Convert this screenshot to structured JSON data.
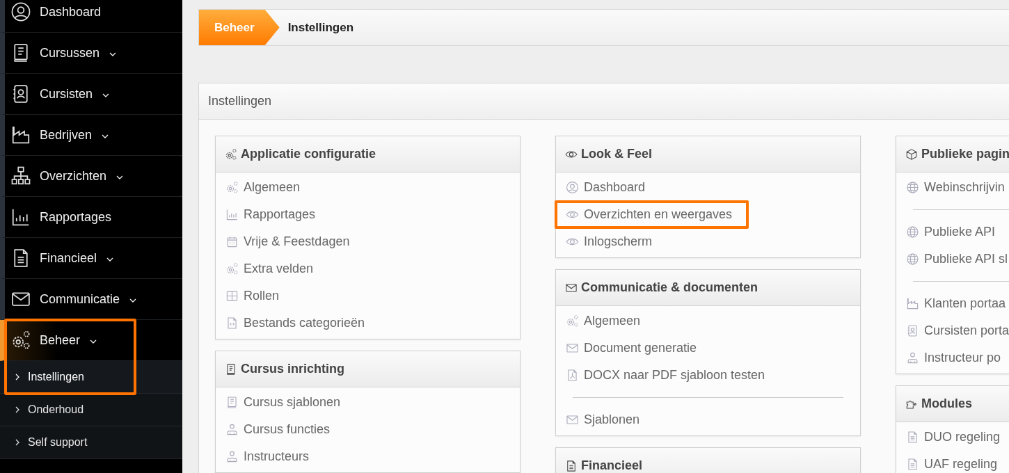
{
  "sidebar": {
    "items": [
      {
        "label": "Dashboard",
        "expandable": false,
        "selected": false,
        "highlighted": false
      },
      {
        "label": "Cursussen",
        "expandable": true,
        "selected": false,
        "highlighted": false
      },
      {
        "label": "Cursisten",
        "expandable": true,
        "selected": false,
        "highlighted": false
      },
      {
        "label": "Bedrijven",
        "expandable": true,
        "selected": false,
        "highlighted": false
      },
      {
        "label": "Overzichten",
        "expandable": true,
        "selected": false,
        "highlighted": false
      },
      {
        "label": "Rapportages",
        "expandable": false,
        "selected": false,
        "highlighted": false
      },
      {
        "label": "Financieel",
        "expandable": true,
        "selected": false,
        "highlighted": false
      },
      {
        "label": "Communicatie",
        "expandable": true,
        "selected": false,
        "highlighted": false
      },
      {
        "label": "Beheer",
        "expandable": true,
        "selected": true,
        "highlighted": true,
        "children": [
          {
            "label": "Instellingen",
            "selected": true
          },
          {
            "label": "Onderhoud",
            "selected": false
          },
          {
            "label": "Self support",
            "selected": false
          }
        ]
      }
    ]
  },
  "breadcrumb": [
    {
      "label": "Beheer",
      "selected": false
    },
    {
      "label": "Instellingen",
      "selected": true
    }
  ],
  "panel": {
    "title": "Instellingen",
    "columns": [
      [
        {
          "title": "Applicatie configuratie",
          "items": [
            {
              "kind": "link",
              "label": "Algemeen",
              "highlighted": false
            },
            {
              "kind": "link",
              "label": "Rapportages",
              "highlighted": false
            },
            {
              "kind": "link",
              "label": "Vrije & Feestdagen",
              "highlighted": false
            },
            {
              "kind": "link",
              "label": "Extra velden",
              "highlighted": false
            },
            {
              "kind": "link",
              "label": "Rollen",
              "highlighted": false
            },
            {
              "kind": "link",
              "label": "Bestands categorieën",
              "highlighted": false
            }
          ]
        },
        {
          "title": "Cursus inrichting",
          "items": [
            {
              "kind": "link",
              "label": "Cursus sjablonen",
              "highlighted": false
            },
            {
              "kind": "link",
              "label": "Cursus functies",
              "highlighted": false
            },
            {
              "kind": "link",
              "label": "Instructeurs",
              "highlighted": false
            }
          ]
        }
      ],
      [
        {
          "title": "Look & Feel",
          "items": [
            {
              "kind": "link",
              "label": "Dashboard",
              "highlighted": false
            },
            {
              "kind": "link",
              "label": "Overzichten en weergaves",
              "highlighted": true
            },
            {
              "kind": "link",
              "label": "Inlogscherm",
              "highlighted": false
            }
          ]
        },
        {
          "title": "Communicatie & documenten",
          "items": [
            {
              "kind": "link",
              "label": "Algemeen",
              "highlighted": false
            },
            {
              "kind": "link",
              "label": "Document generatie",
              "highlighted": false
            },
            {
              "kind": "link",
              "label": "DOCX naar PDF sjabloon testen",
              "highlighted": false
            },
            {
              "kind": "divider"
            },
            {
              "kind": "link",
              "label": "Sjablonen",
              "highlighted": false
            }
          ]
        },
        {
          "title": "Financieel"
        }
      ],
      [
        {
          "title": "Publieke pagin",
          "items": [
            {
              "kind": "link",
              "label": "Webinschrijvin",
              "highlighted": false
            },
            {
              "kind": "divider"
            },
            {
              "kind": "link",
              "label": "Publieke API",
              "highlighted": false
            },
            {
              "kind": "link",
              "label": "Publieke API sl",
              "highlighted": false
            },
            {
              "kind": "divider"
            },
            {
              "kind": "link",
              "label": "Klanten portaa",
              "highlighted": false
            },
            {
              "kind": "link",
              "label": "Cursisten porta",
              "highlighted": false
            },
            {
              "kind": "link",
              "label": "Instructeur po",
              "highlighted": false
            }
          ]
        },
        {
          "title": "Modules",
          "items": [
            {
              "kind": "link",
              "label": "DUO regeling",
              "highlighted": false
            },
            {
              "kind": "link",
              "label": "UAF regeling",
              "highlighted": false
            }
          ]
        }
      ]
    ]
  }
}
